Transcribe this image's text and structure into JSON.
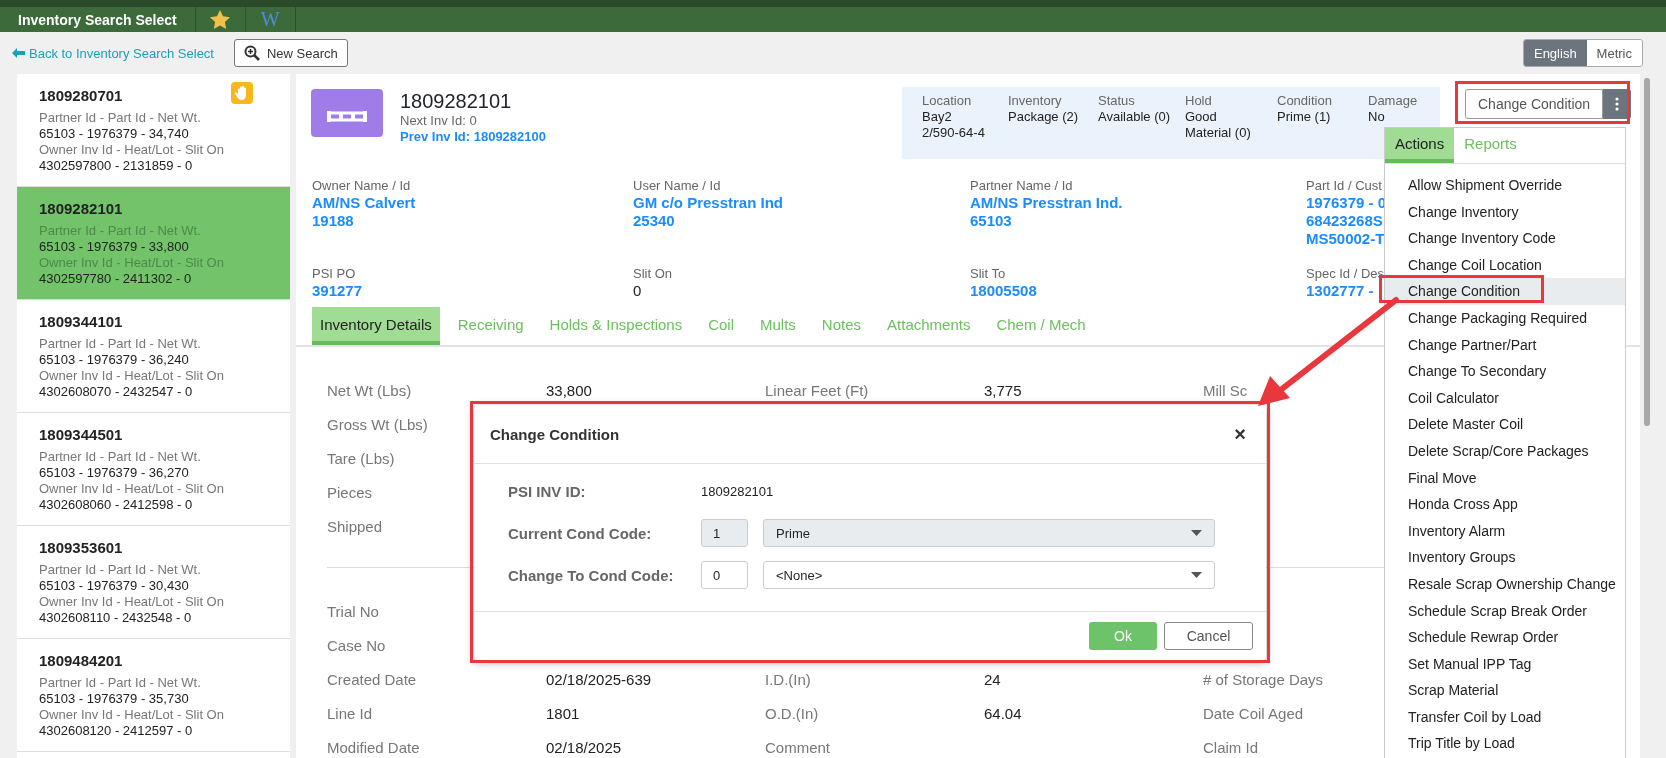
{
  "app_tabs": [
    {
      "kind": "text",
      "label": "Inventory Search Select"
    },
    {
      "kind": "star"
    },
    {
      "kind": "wiki",
      "label": "W"
    }
  ],
  "back_link": "Back to Inventory Search Select",
  "new_search": "New Search",
  "units": [
    {
      "label": "English",
      "selected": true
    },
    {
      "label": "Metric",
      "selected": false
    }
  ],
  "inventory_list": [
    {
      "id": "1809280701",
      "hold": true,
      "selected": false,
      "line_1_label": "Partner Id - Part Id - Net Wt.",
      "line_1": "65103 - 1976379 - 34,740",
      "line_2_label": "Owner Inv Id - Heat/Lot - Slit On",
      "line_2": "4302597800 - 2131859 - 0"
    },
    {
      "id": "1809282101",
      "hold": false,
      "selected": true,
      "line_1_label": "Partner Id - Part Id - Net Wt.",
      "line_1": "65103 - 1976379 - 33,800",
      "line_2_label": "Owner Inv Id - Heat/Lot - Slit On",
      "line_2": "4302597780 - 2411302 - 0"
    },
    {
      "id": "1809344101",
      "hold": false,
      "selected": false,
      "line_1_label": "Partner Id - Part Id - Net Wt.",
      "line_1": "65103 - 1976379 - 36,240",
      "line_2_label": "Owner Inv Id - Heat/Lot - Slit On",
      "line_2": "4302608070 - 2432547 - 0"
    },
    {
      "id": "1809344501",
      "hold": false,
      "selected": false,
      "line_1_label": "Partner Id - Part Id - Net Wt.",
      "line_1": "65103 - 1976379 - 36,270",
      "line_2_label": "Owner Inv Id - Heat/Lot - Slit On",
      "line_2": "4302608060 - 2412598 - 0"
    },
    {
      "id": "1809353601",
      "hold": false,
      "selected": false,
      "line_1_label": "Partner Id - Part Id - Net Wt.",
      "line_1": "65103 - 1976379 - 30,430",
      "line_2_label": "Owner Inv Id - Heat/Lot - Slit On",
      "line_2": "4302608110 - 2432548 - 0"
    },
    {
      "id": "1809484201",
      "hold": false,
      "selected": false,
      "line_1_label": "Partner Id - Part Id - Net Wt.",
      "line_1": "65103 - 1976379 - 35,730",
      "line_2_label": "Owner Inv Id - Heat/Lot - Slit On",
      "line_2": "4302608120 - 2412597 - 0"
    }
  ],
  "header": {
    "inv_id": "1809282101",
    "next_label": "Next Inv Id:",
    "next_value": "0",
    "prev_label": "Prev Inv Id:",
    "prev_value": "1809282100"
  },
  "summary": [
    {
      "label": "Location",
      "lines": [
        "Bay2",
        "2/590-64-4"
      ]
    },
    {
      "label": "Inventory",
      "lines": [
        "Package (2)"
      ]
    },
    {
      "label": "Status",
      "lines": [
        "Available (0)"
      ]
    },
    {
      "label": "Hold",
      "lines": [
        "Good",
        "Material (0)"
      ]
    },
    {
      "label": "Condition",
      "lines": [
        "Prime (1)"
      ]
    },
    {
      "label": "Damage",
      "lines": [
        "No"
      ]
    }
  ],
  "action_button": "Change Condition",
  "fields": [
    {
      "label": "Owner Name / Id",
      "values": [
        "AM/NS Calvert",
        "19188"
      ],
      "link": true
    },
    {
      "label": "User Name / Id",
      "values": [
        "GM c/o Presstran Ind",
        "25340"
      ],
      "link": true
    },
    {
      "label": "Partner Name / Id",
      "values": [
        "AM/NS Presstran Ind.",
        "65103"
      ],
      "link": true
    },
    {
      "label": "Part Id / Cust",
      "values": [
        "1976379 - 0",
        "68423268S",
        "MS50002-T"
      ],
      "link": true
    },
    {
      "label": "PSI PO",
      "values": [
        "391277"
      ],
      "link": true
    },
    {
      "label": "Slit On",
      "values": [
        "0"
      ],
      "link": false
    },
    {
      "label": "Slit To",
      "values": [
        "18005508"
      ],
      "link": true
    },
    {
      "label": "Spec Id / Des",
      "values": [
        "1302777 -"
      ],
      "link": true
    }
  ],
  "detail_tabs": [
    {
      "label": "Inventory Details",
      "selected": true
    },
    {
      "label": "Receiving",
      "selected": false
    },
    {
      "label": "Holds & Inspections",
      "selected": false
    },
    {
      "label": "Coil",
      "selected": false
    },
    {
      "label": "Mults",
      "selected": false
    },
    {
      "label": "Notes",
      "selected": false
    },
    {
      "label": "Attachments",
      "selected": false
    },
    {
      "label": "Chem / Mech",
      "selected": false
    }
  ],
  "details": [
    [
      {
        "cells": [
          {
            "label": "Net Wt (Lbs)",
            "value": "33,800"
          },
          {
            "label": "Linear Feet (Ft)",
            "value": "3,775"
          },
          {
            "label": "Mill Sc"
          }
        ]
      },
      {
        "cells": [
          {
            "label": "Gross Wt (Lbs)"
          }
        ]
      },
      {
        "cells": [
          {
            "label": "Tare (Lbs)"
          }
        ]
      },
      {
        "cells": [
          {
            "label": "Pieces"
          }
        ]
      },
      {
        "cells": [
          {
            "label": "Shipped"
          }
        ]
      }
    ],
    [
      {
        "cells": [
          {
            "label": "Trial No"
          }
        ]
      },
      {
        "cells": [
          {
            "label": "Case No"
          }
        ]
      },
      {
        "cells": [
          {
            "label": "Created Date",
            "value": "02/18/2025-639"
          },
          {
            "label": "I.D.(In)",
            "value": "24"
          },
          {
            "label": "# of Storage Days"
          }
        ]
      },
      {
        "cells": [
          {
            "label": "Line Id",
            "value": "1801"
          },
          {
            "label": "O.D.(In)",
            "value": "64.04"
          },
          {
            "label": "Date Coil Aged"
          }
        ]
      },
      {
        "cells": [
          {
            "label": "Modified Date",
            "value": "02/18/2025"
          },
          {
            "label": "Comment"
          },
          {
            "label": "Claim Id"
          }
        ]
      }
    ]
  ],
  "menu": {
    "tabs": [
      {
        "label": "Actions",
        "selected": true
      },
      {
        "label": "Reports",
        "selected": false
      }
    ],
    "items": [
      {
        "label": "Allow Shipment Override",
        "selected": false
      },
      {
        "label": "Change Inventory",
        "selected": false
      },
      {
        "label": "Change Inventory Code",
        "selected": false
      },
      {
        "label": "Change Coil Location",
        "selected": false
      },
      {
        "label": "Change Condition",
        "selected": true
      },
      {
        "label": "Change Packaging Required",
        "selected": false
      },
      {
        "label": "Change Partner/Part",
        "selected": false
      },
      {
        "label": "Change To Secondary",
        "selected": false
      },
      {
        "label": "Coil Calculator",
        "selected": false
      },
      {
        "label": "Delete Master Coil",
        "selected": false
      },
      {
        "label": "Delete Scrap/Core Packages",
        "selected": false
      },
      {
        "label": "Final Move",
        "selected": false
      },
      {
        "label": "Honda Cross App",
        "selected": false
      },
      {
        "label": "Inventory Alarm",
        "selected": false
      },
      {
        "label": "Inventory Groups",
        "selected": false
      },
      {
        "label": "Resale Scrap Ownership Change",
        "selected": false
      },
      {
        "label": "Schedule Scrap Break Order",
        "selected": false
      },
      {
        "label": "Schedule Rewrap Order",
        "selected": false
      },
      {
        "label": "Set Manual IPP Tag",
        "selected": false
      },
      {
        "label": "Scrap Material",
        "selected": false
      },
      {
        "label": "Transfer Coil by Load",
        "selected": false
      },
      {
        "label": "Trip Title by Load",
        "selected": false
      }
    ]
  },
  "modal": {
    "title": "Change Condition",
    "close": "×",
    "rows": [
      {
        "kind": "text",
        "label": "PSI INV ID:",
        "value": "1809282101"
      },
      {
        "kind": "select",
        "label": "Current Cond Code:",
        "code": "1",
        "option": "Prime",
        "disabled": true
      },
      {
        "kind": "select",
        "label": "Change To Cond Code:",
        "code": "0",
        "option": "<None>",
        "disabled": false
      }
    ],
    "ok": "Ok",
    "cancel": "Cancel"
  }
}
